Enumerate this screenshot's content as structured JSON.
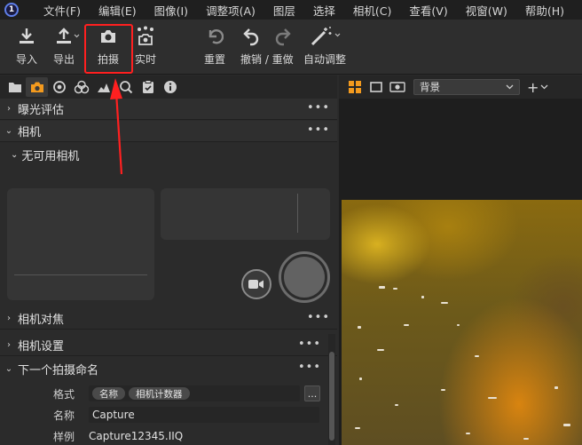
{
  "app": {
    "logo_letter": "1"
  },
  "menu": [
    "文件(F)",
    "编辑(E)",
    "图像(I)",
    "调整项(A)",
    "图层",
    "选择",
    "相机(C)",
    "查看(V)",
    "视窗(W)",
    "帮助(H)"
  ],
  "toolbar": {
    "import_label": "导入",
    "export_label": "导出",
    "capture_label": "拍摄",
    "live_label": "实时",
    "reset_label": "重置",
    "undo_redo_label": "撤销 / 重做",
    "auto_adjust_label": "自动调整"
  },
  "viewer": {
    "background_select": "背景"
  },
  "panels": {
    "exposure_title": "曝光评估",
    "camera_title": "相机",
    "no_camera": "无可用相机",
    "camera_focus_title": "相机对焦",
    "camera_settings_title": "相机设置",
    "next_capture_naming_title": "下一个拍摄命名",
    "more": "•••"
  },
  "naming": {
    "format_label": "格式",
    "format_tokens": [
      "名称",
      "相机计数器"
    ],
    "name_label": "名称",
    "name_value": "Capture",
    "sample_label": "样例",
    "sample_value": "Capture12345.IIQ",
    "dots": "..."
  },
  "colors": {
    "highlight": "#ff2020",
    "accent_orange": "#f39a1e"
  }
}
